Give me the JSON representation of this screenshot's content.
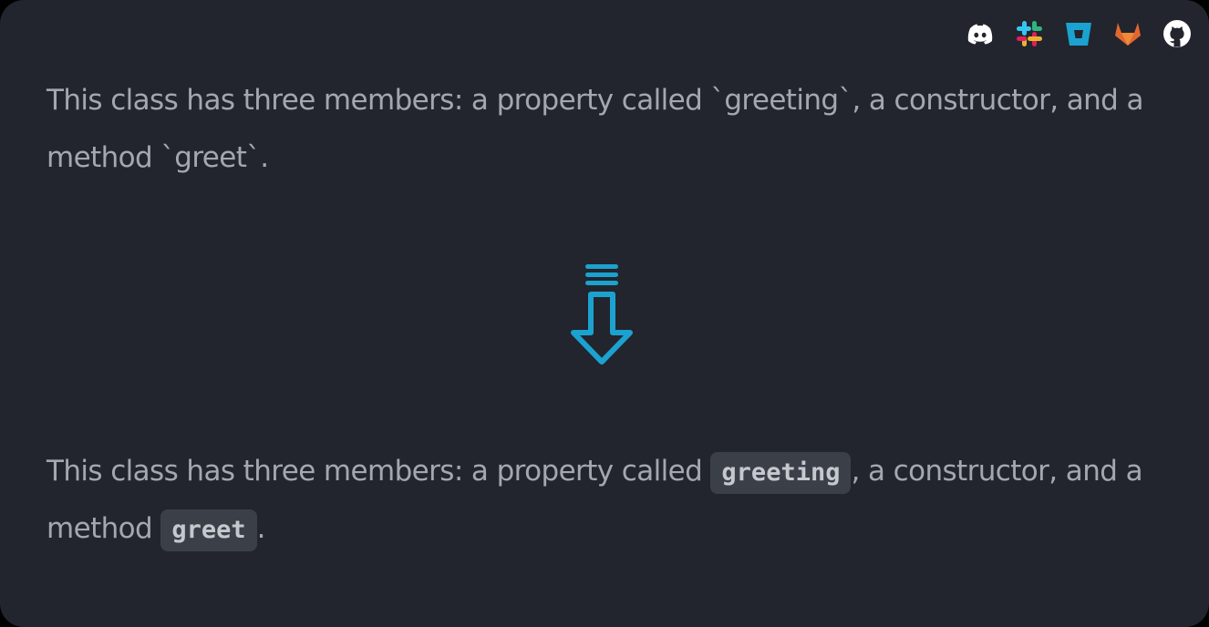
{
  "colors": {
    "background": "#22252d",
    "text": "#a4a8ae",
    "code_bg": "#3b4048",
    "accent": "#1ba2d0"
  },
  "header_icons": [
    "discord-icon",
    "slack-icon",
    "bitbucket-icon",
    "gitlab-icon",
    "github-icon"
  ],
  "before": {
    "text_line": "This class has three members: a property called `greeting`, a constructor, and a method `greet`."
  },
  "arrow": {
    "icon": "arrow-down-icon"
  },
  "after": {
    "part1": "This class has three members: a property called ",
    "code1": "greeting",
    "part2": ", a constructor, and a method ",
    "code2": "greet",
    "part3": "."
  }
}
